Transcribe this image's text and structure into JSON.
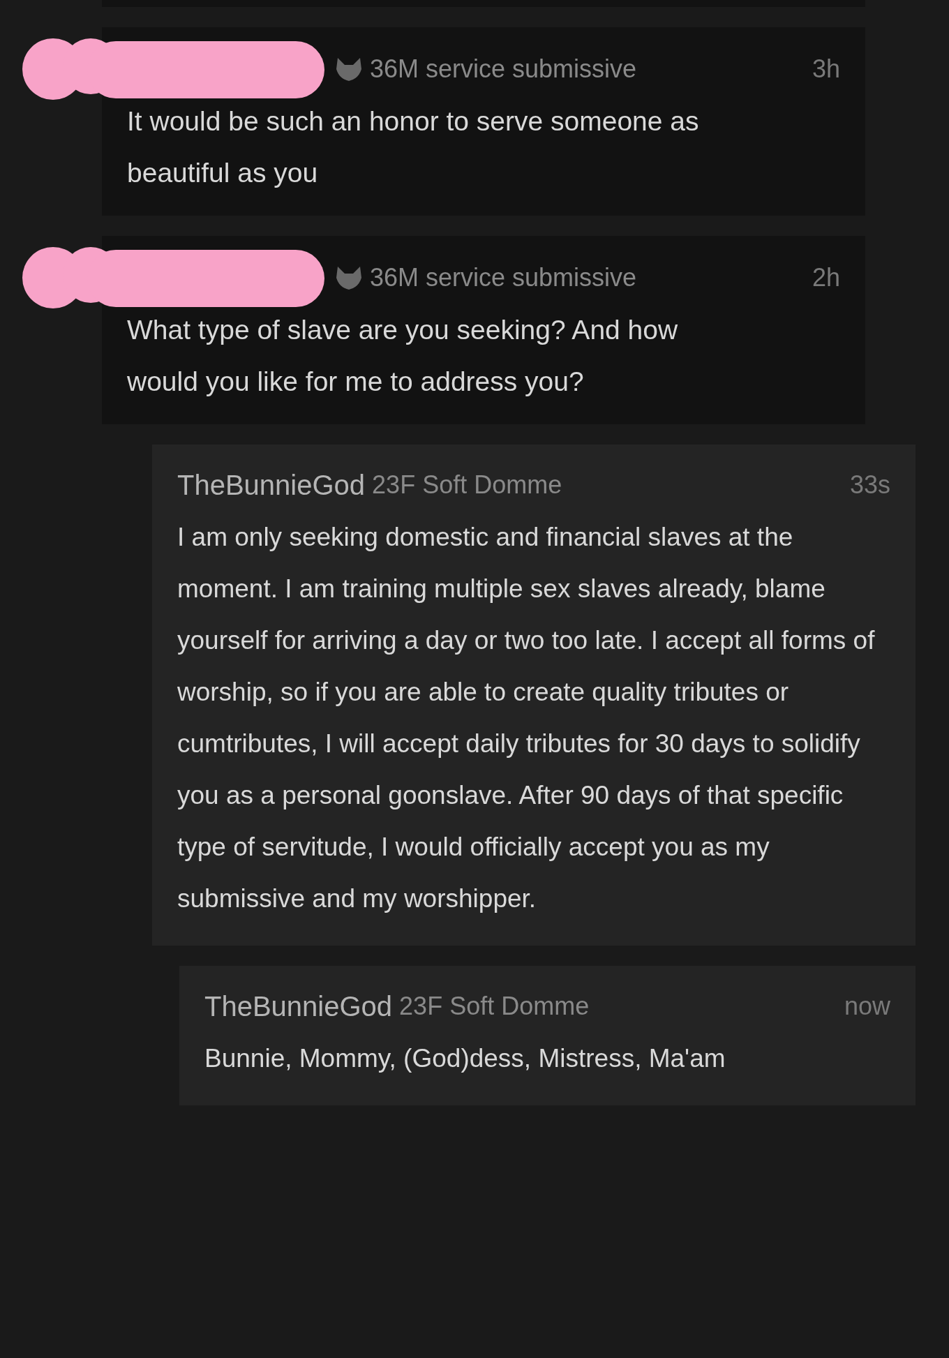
{
  "comments": [
    {
      "meta": "36M service submissive",
      "time": "3h",
      "text": "It would be such an honor to serve someone as beautiful as you",
      "redacted": true
    },
    {
      "meta": "36M service submissive",
      "time": "2h",
      "text": "What type of slave are you seeking? And how would you like for me to address you?",
      "redacted": true,
      "children": [
        {
          "author": "TheBunnieGod",
          "meta": "23F Soft Domme",
          "time": "33s",
          "text": "I am only seeking domestic and financial slaves at the moment. I am training multiple sex slaves already, blame yourself for arriving a day or two too late. I accept all forms of worship, so if you are able to create quality tributes or cumtributes, I will accept daily tributes for 30 days to solidify you as a personal goonslave. After 90 days of that specific type of servitude, I would officially accept you as my submissive and my worshipper.",
          "redacted": false,
          "children": [
            {
              "author": "TheBunnieGod",
              "meta": "23F Soft Domme",
              "time": "now",
              "text": "Bunnie, Mommy, (God)dess, Mistress, Ma'am",
              "redacted": false
            }
          ]
        }
      ]
    }
  ]
}
